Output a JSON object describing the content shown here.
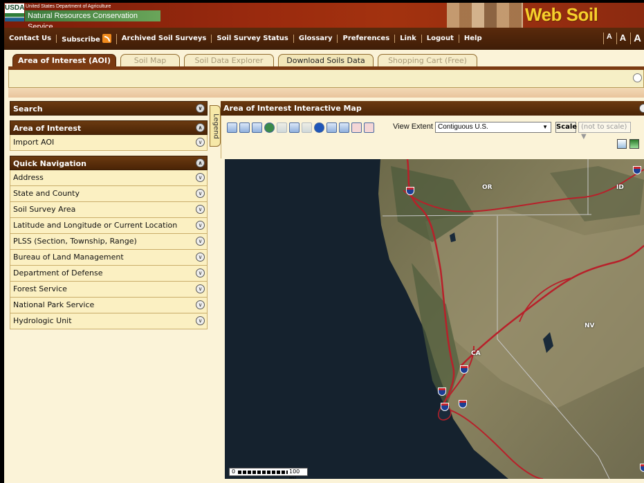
{
  "banner": {
    "usda_abbrev": "USDA",
    "department": "United States Department of Agriculture",
    "agency": "Natural Resources Conservation Service",
    "site_title": "Web Soil Survey"
  },
  "nav": {
    "items": [
      "Contact Us",
      "Subscribe",
      "Archived Soil Surveys",
      "Soil Survey Status",
      "Glossary",
      "Preferences",
      "Link",
      "Logout",
      "Help"
    ],
    "font_size_buttons": [
      "A",
      "A",
      "A"
    ]
  },
  "tabs": [
    {
      "label": "Area of Interest (AOI)",
      "state": "active"
    },
    {
      "label": "Soil Map",
      "state": "disabled"
    },
    {
      "label": "Soil Data Explorer",
      "state": "disabled"
    },
    {
      "label": "Download Soils Data",
      "state": "enabled"
    },
    {
      "label": "Shopping Cart (Free)",
      "state": "disabled"
    }
  ],
  "left_panel": {
    "search_header": "Search",
    "aoi_header": "Area of Interest",
    "aoi_items": [
      "Import AOI"
    ],
    "quicknav_header": "Quick Navigation",
    "quicknav_items": [
      "Address",
      "State and County",
      "Soil Survey Area",
      "Latitude and Longitude or Current Location",
      "PLSS (Section, Township, Range)",
      "Bureau of Land Management",
      "Department of Defense",
      "Forest Service",
      "National Park Service",
      "Hydrologic Unit"
    ]
  },
  "legend_tab": "Legend",
  "map_panel": {
    "title": "Area of Interest Interactive Map",
    "view_extent_label": "View Extent",
    "view_extent_value": "Contiguous U.S.",
    "scale_label": "Scale",
    "scale_value": "(not to scale)",
    "scalebar_start": "0",
    "scalebar_label": "100 mi",
    "state_labels": [
      "OR",
      "ID",
      "NV",
      "CA"
    ],
    "aoi_tool_labels": [
      "AOI",
      "AOI"
    ]
  },
  "colors": {
    "brand_brown": "#7a3a12",
    "header_brown": "#4a2406",
    "panel_row_bg": "#fbf0c2",
    "title_gold": "#f6d02c",
    "road_red": "#b8202a"
  }
}
